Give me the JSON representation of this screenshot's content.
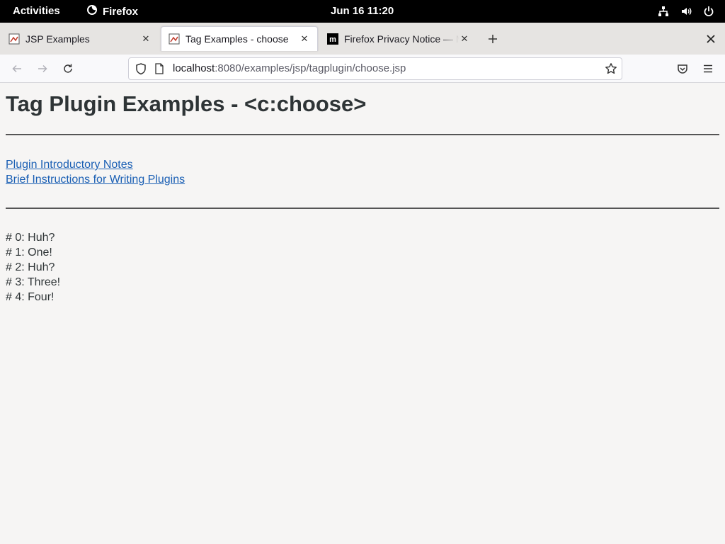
{
  "system_bar": {
    "activities": "Activities",
    "app_name": "Firefox",
    "clock": "Jun 16  11:20",
    "icons": [
      "network-icon",
      "volume-icon",
      "power-icon"
    ]
  },
  "tabs": [
    {
      "title": "JSP Examples",
      "active": false,
      "icon": "jsp-favicon-icon"
    },
    {
      "title": "Tag Examples - choose",
      "active": true,
      "icon": "jsp-favicon-icon"
    },
    {
      "title": "Firefox Privacy Notice — M",
      "active": false,
      "icon": "mozilla-icon"
    }
  ],
  "navigation": {
    "url_host": "localhost",
    "url_rest": ":8080/examples/jsp/tagplugin/choose.jsp",
    "back_enabled": false,
    "forward_enabled": false
  },
  "page": {
    "heading": "Tag Plugin Examples - <c:choose>",
    "links": [
      {
        "label": "Plugin Introductory Notes"
      },
      {
        "label": "Brief Instructions for Writing Plugins"
      }
    ],
    "results": [
      "# 0: Huh?",
      "# 1: One!",
      "# 2: Huh?",
      "# 3: Three!",
      "# 4: Four!"
    ]
  },
  "colors": {
    "link": "#1a5fb4",
    "text": "#2e3436",
    "page_background": "#f6f5f4"
  }
}
